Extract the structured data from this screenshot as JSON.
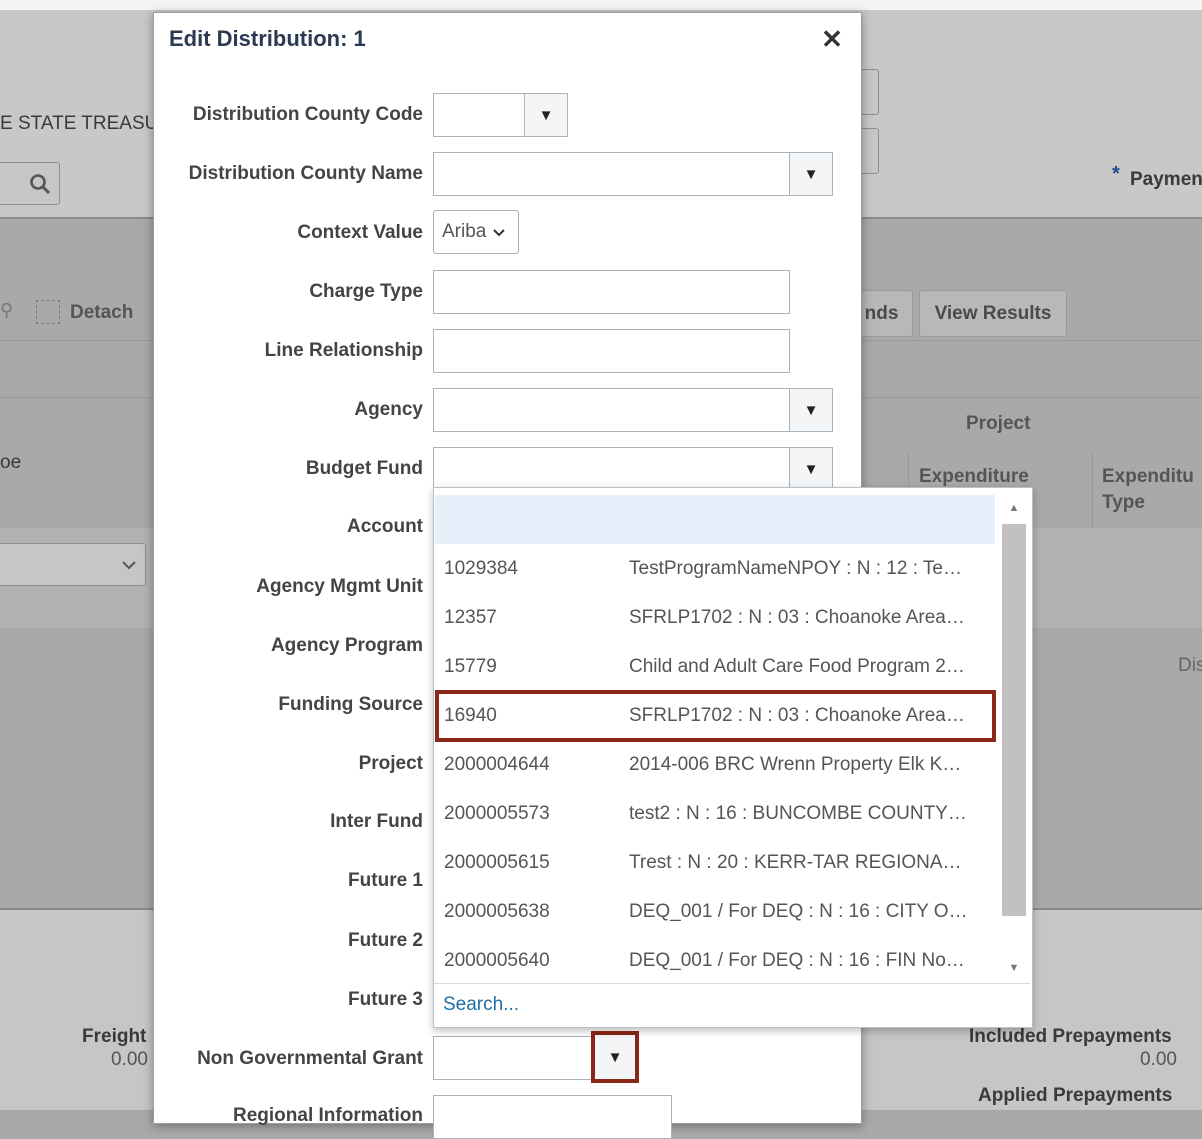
{
  "background": {
    "treasury_text": "E STATE TREASU",
    "payment_label": "Paymen",
    "required_star": "*",
    "detach_label": "Detach",
    "funds_btn": "nds",
    "view_results_btn": "View Results",
    "project_header": "Project",
    "expenditure_col1": "Expenditure",
    "expenditure_col2": "Expenditu",
    "expenditure_col2_sub": "Type",
    "left_col_text": "oe",
    "dis_text": "Dis",
    "freight_label": "Freight",
    "freight_value": "0.00",
    "included_prepayments_label": "Included Prepayments",
    "included_prepayments_value": "0.00",
    "applied_prepayments_label": "Applied Prepayments"
  },
  "dialog": {
    "title": "Edit Distribution: 1",
    "close_glyph": "✕",
    "fields": {
      "county_code": "Distribution County Code",
      "county_name": "Distribution County Name",
      "context_value": "Context Value",
      "charge_type": "Charge Type",
      "line_relationship": "Line Relationship",
      "agency": "Agency",
      "budget_fund": "Budget Fund",
      "account": "Account",
      "agency_mgmt_unit": "Agency Mgmt Unit",
      "agency_program": "Agency Program",
      "funding_source": "Funding Source",
      "project": "Project",
      "inter_fund": "Inter Fund",
      "future_1": "Future 1",
      "future_2": "Future 2",
      "future_3": "Future 3",
      "non_governmental_grant": "Non Governmental Grant",
      "regional_information": "Regional Information"
    },
    "context_value_selected": "Ariba",
    "dropdown_glyph": "▼"
  },
  "popup": {
    "rows": [
      {
        "code": "",
        "desc": ""
      },
      {
        "code": "1029384",
        "desc": "TestProgramNameNPOY : N : 12 : Te…"
      },
      {
        "code": "12357",
        "desc": "SFRLP1702 : N : 03 : Choanoke Area…"
      },
      {
        "code": "15779",
        "desc": "Child and Adult Care Food Program 2…"
      },
      {
        "code": "16940",
        "desc": "SFRLP1702 : N : 03 : Choanoke Area…"
      },
      {
        "code": "2000004644",
        "desc": "2014-006 BRC Wrenn Property Elk K…"
      },
      {
        "code": "2000005573",
        "desc": "test2 : N : 16 : BUNCOMBE COUNTY…"
      },
      {
        "code": "2000005615",
        "desc": "Trest : N : 20 : KERR-TAR REGIONA…"
      },
      {
        "code": "2000005638",
        "desc": "DEQ_001 / For DEQ : N : 16 : CITY O…"
      },
      {
        "code": "2000005640",
        "desc": "DEQ_001 / For DEQ : N : 16 : FIN No…"
      }
    ],
    "search_link": "Search...",
    "scroll_up_glyph": "▲",
    "scroll_down_glyph": "▼"
  },
  "colors": {
    "highlight": "#8b2716",
    "overlay_bg": "#a9a9a9",
    "link": "#1f6fa8"
  }
}
